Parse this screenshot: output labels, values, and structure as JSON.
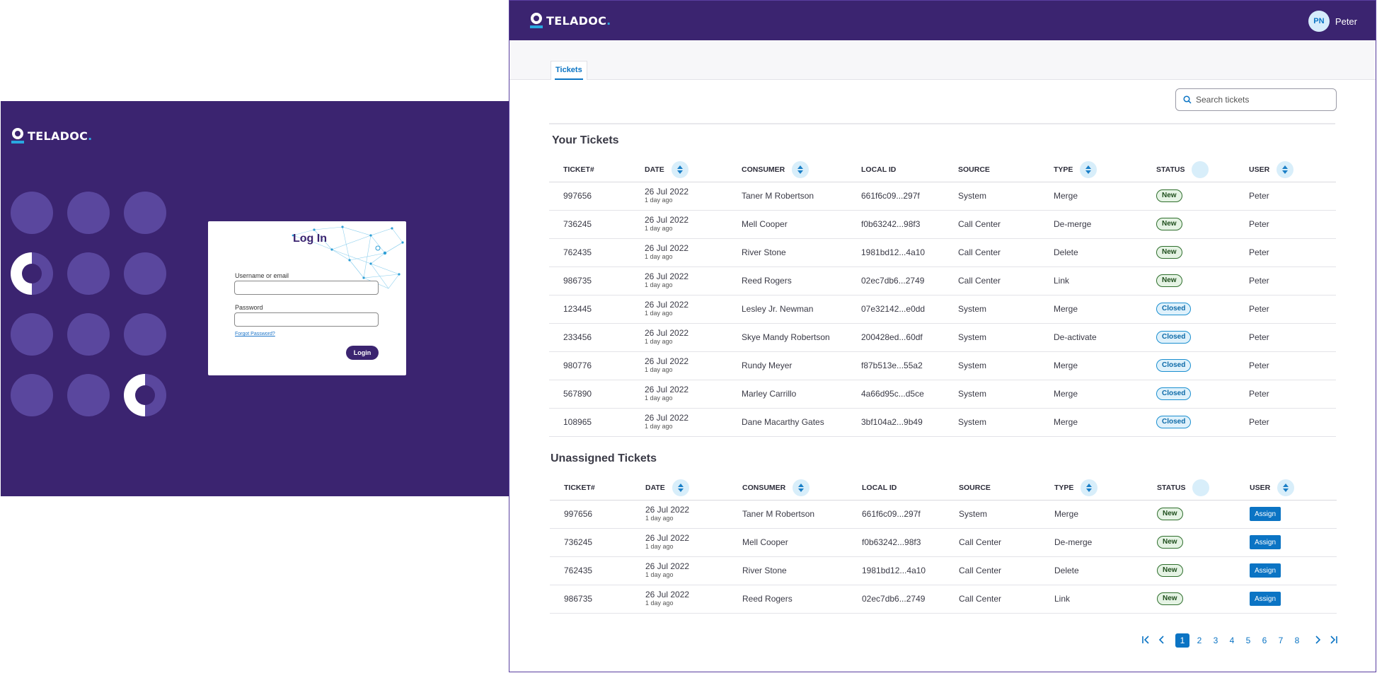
{
  "brand": {
    "name": "TELADOC",
    "dot": "."
  },
  "login": {
    "title": "Log In",
    "username_label": "Username or email",
    "password_label": "Password",
    "forgot_label": "Forgot Password?",
    "submit_label": "Login"
  },
  "header": {
    "avatar_initials": "PN",
    "user_name": "Peter"
  },
  "tabs": [
    {
      "label": "Tickets"
    }
  ],
  "search": {
    "placeholder": "Search tickets"
  },
  "columns": [
    "TICKET#",
    "DATE",
    "CONSUMER",
    "LOCAL ID",
    "SOURCE",
    "TYPE",
    "STATUS",
    "USER"
  ],
  "your_tickets": {
    "title": "Your Tickets",
    "rows": [
      {
        "ticket": "997656",
        "date": "26 Jul 2022",
        "ago": "1 day ago",
        "consumer": "Taner M Robertson",
        "local_id": "661f6c09...297f",
        "source": "System",
        "type": "Merge",
        "status": "New",
        "user": "Peter"
      },
      {
        "ticket": "736245",
        "date": "26 Jul 2022",
        "ago": "1 day ago",
        "consumer": "Mell Cooper",
        "local_id": "f0b63242...98f3",
        "source": "Call Center",
        "type": "De-merge",
        "status": "New",
        "user": "Peter"
      },
      {
        "ticket": "762435",
        "date": "26 Jul 2022",
        "ago": "1 day ago",
        "consumer": "River Stone",
        "local_id": "1981bd12...4a10",
        "source": "Call Center",
        "type": "Delete",
        "status": "New",
        "user": "Peter"
      },
      {
        "ticket": "986735",
        "date": "26 Jul 2022",
        "ago": "1 day ago",
        "consumer": "Reed Rogers",
        "local_id": "02ec7db6...2749",
        "source": "Call Center",
        "type": "Link",
        "status": "New",
        "user": "Peter"
      },
      {
        "ticket": "123445",
        "date": "26 Jul 2022",
        "ago": "1 day ago",
        "consumer": "Lesley Jr. Newman",
        "local_id": "07e32142...e0dd",
        "source": "System",
        "type": "Merge",
        "status": "Closed",
        "user": "Peter"
      },
      {
        "ticket": "233456",
        "date": "26 Jul 2022",
        "ago": "1 day ago",
        "consumer": "Skye Mandy Robertson",
        "local_id": "200428ed...60df",
        "source": "System",
        "type": "De-activate",
        "status": "Closed",
        "user": "Peter"
      },
      {
        "ticket": "980776",
        "date": "26 Jul 2022",
        "ago": "1 day ago",
        "consumer": "Rundy Meyer",
        "local_id": "f87b513e...55a2",
        "source": "System",
        "type": "Merge",
        "status": "Closed",
        "user": "Peter"
      },
      {
        "ticket": "567890",
        "date": "26 Jul 2022",
        "ago": "1 day ago",
        "consumer": "Marley Carrillo",
        "local_id": "4a66d95c...d5ce",
        "source": "System",
        "type": "Merge",
        "status": "Closed",
        "user": "Peter"
      },
      {
        "ticket": "108965",
        "date": "26 Jul 2022",
        "ago": "1 day ago",
        "consumer": "Dane Macarthy Gates",
        "local_id": "3bf104a2...9b49",
        "source": "System",
        "type": "Merge",
        "status": "Closed",
        "user": "Peter"
      }
    ]
  },
  "unassigned_tickets": {
    "title": "Unassigned Tickets",
    "assign_label": "Assign",
    "rows": [
      {
        "ticket": "997656",
        "date": "26 Jul 2022",
        "ago": "1 day ago",
        "consumer": "Taner M Robertson",
        "local_id": "661f6c09...297f",
        "source": "System",
        "type": "Merge",
        "status": "New"
      },
      {
        "ticket": "736245",
        "date": "26 Jul 2022",
        "ago": "1 day ago",
        "consumer": "Mell Cooper",
        "local_id": "f0b63242...98f3",
        "source": "Call Center",
        "type": "De-merge",
        "status": "New"
      },
      {
        "ticket": "762435",
        "date": "26 Jul 2022",
        "ago": "1 day ago",
        "consumer": "River Stone",
        "local_id": "1981bd12...4a10",
        "source": "Call Center",
        "type": "Delete",
        "status": "New"
      },
      {
        "ticket": "986735",
        "date": "26 Jul 2022",
        "ago": "1 day ago",
        "consumer": "Reed Rogers",
        "local_id": "02ec7db6...2749",
        "source": "Call Center",
        "type": "Link",
        "status": "New"
      }
    ]
  },
  "pagination": {
    "pages": [
      "1",
      "2",
      "3",
      "4",
      "5",
      "6",
      "7",
      "8"
    ],
    "current": "1"
  },
  "colors": {
    "brand_purple": "#3b2470",
    "accent_blue": "#0b74c4",
    "light_purple": "#5a479e",
    "logo_blue": "#29a8e0"
  }
}
